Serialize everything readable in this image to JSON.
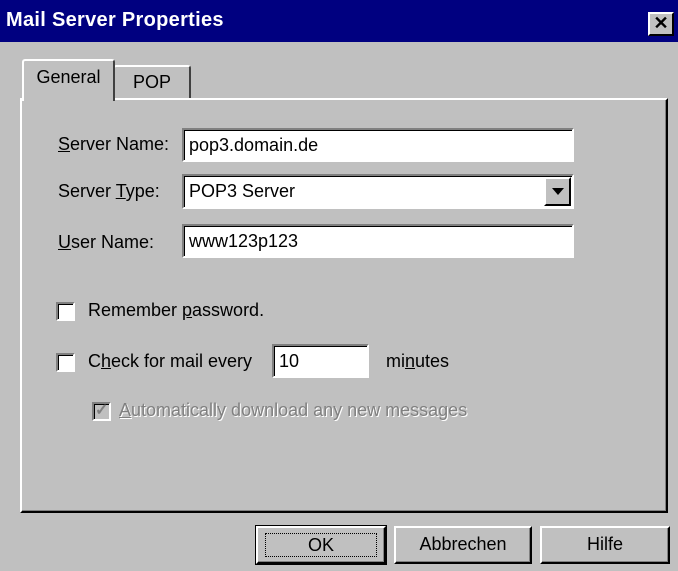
{
  "window": {
    "title": "Mail Server Properties",
    "close_glyph": "✕"
  },
  "tabs": [
    {
      "label": "General",
      "active": true
    },
    {
      "label": "POP",
      "active": false
    }
  ],
  "general": {
    "server_name": {
      "label_mnemonic": "S",
      "label_rest": "erver Name:",
      "value": "pop3.domain.de"
    },
    "server_type": {
      "label_prefix": "Server ",
      "label_mnemonic": "T",
      "label_rest": "ype:",
      "value": "POP3 Server"
    },
    "user_name": {
      "label_mnemonic": "U",
      "label_rest": "ser Name:",
      "value": "www123p123"
    },
    "remember_password": {
      "label_prefix": "Remember ",
      "label_mnemonic": "p",
      "label_rest": "assword.",
      "checked": false
    },
    "check_mail": {
      "label_prefix": "C",
      "label_mnemonic": "h",
      "label_rest": "eck for mail every",
      "interval": "10",
      "checked": false
    },
    "minutes": {
      "label_prefix": "mi",
      "label_mnemonic": "n",
      "label_rest": "utes"
    },
    "auto_download": {
      "label_mnemonic": "A",
      "label_rest": "utomatically download any new messages",
      "checked": true,
      "enabled": false
    }
  },
  "buttons": {
    "ok": "OK",
    "cancel": "Abbrechen",
    "help": "Hilfe"
  },
  "colors": {
    "titlebar": "#000080",
    "face": "#c0c0c0"
  }
}
